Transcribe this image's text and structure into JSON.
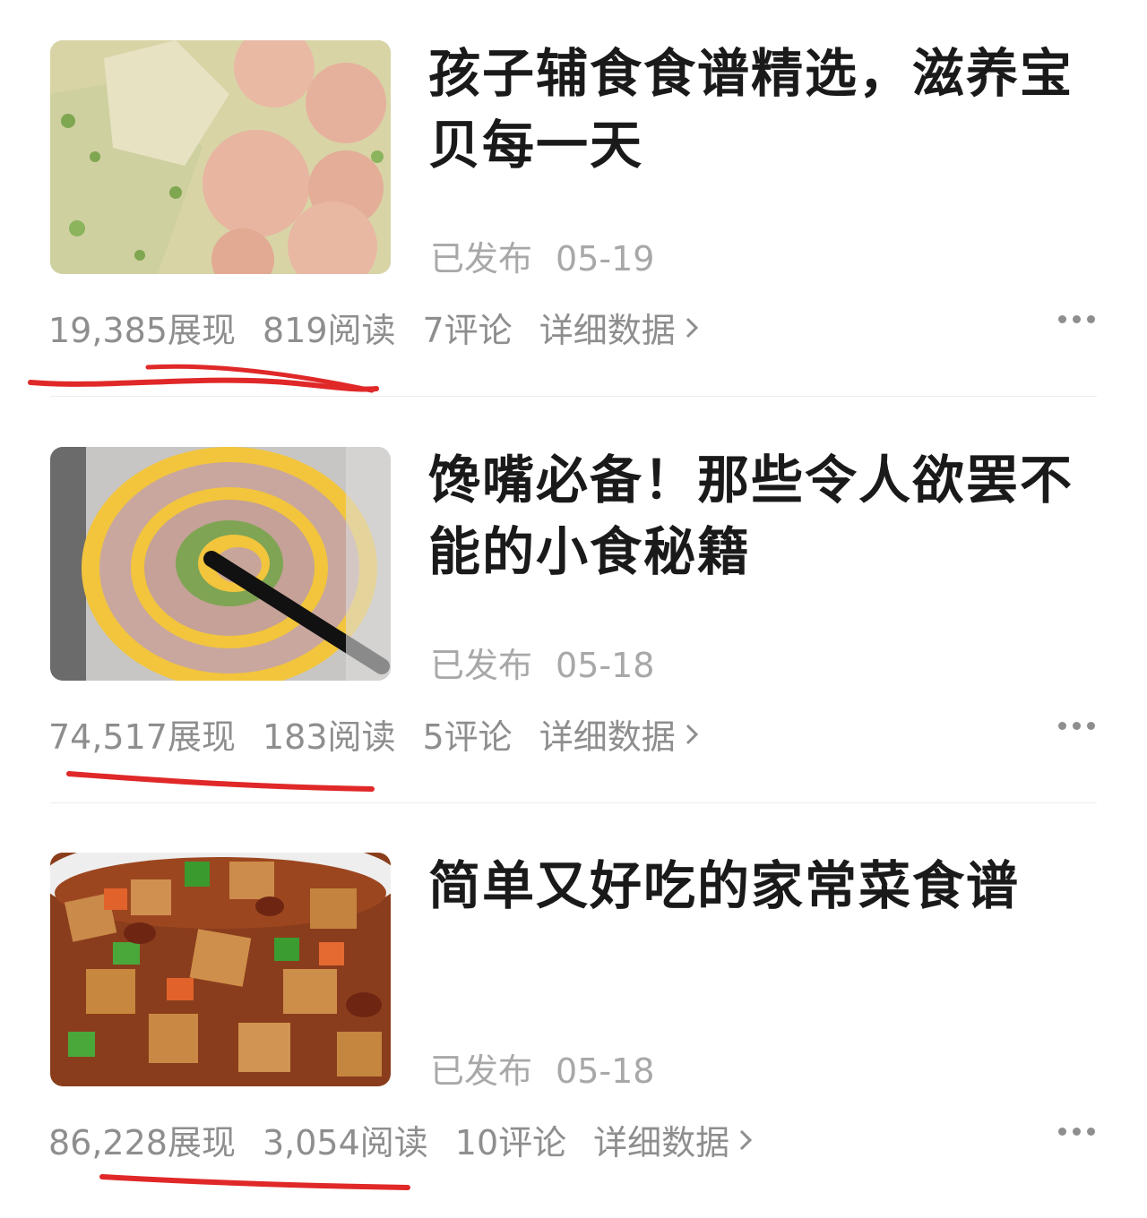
{
  "articles": [
    {
      "title": "孩子辅食食谱精选，滋养宝贝每一天",
      "status": "已发布",
      "date": "05-19",
      "impressions": "19,385展现",
      "reads": "819阅读",
      "comments": "7评论",
      "detail": "详细数据",
      "thumbnail": "shrimp-ball-soup"
    },
    {
      "title": "馋嘴必备！那些令人欲罢不能的小食秘籍",
      "status": "已发布",
      "date": "05-18",
      "impressions": "74,517展现",
      "reads": "183阅读",
      "comments": "5评论",
      "detail": "详细数据",
      "thumbnail": "egg-meat-roll"
    },
    {
      "title": "简单又好吃的家常菜食谱",
      "status": "已发布",
      "date": "05-18",
      "impressions": "86,228展现",
      "reads": "3,054阅读",
      "comments": "10评论",
      "detail": "详细数据",
      "thumbnail": "tofu-stir-fry"
    }
  ],
  "colors": {
    "title": "#1a1a1a",
    "muted": "#8e8e8e",
    "annotation": "#e02828"
  },
  "icons": [
    "chevron-right-icon",
    "more-dots-icon"
  ]
}
